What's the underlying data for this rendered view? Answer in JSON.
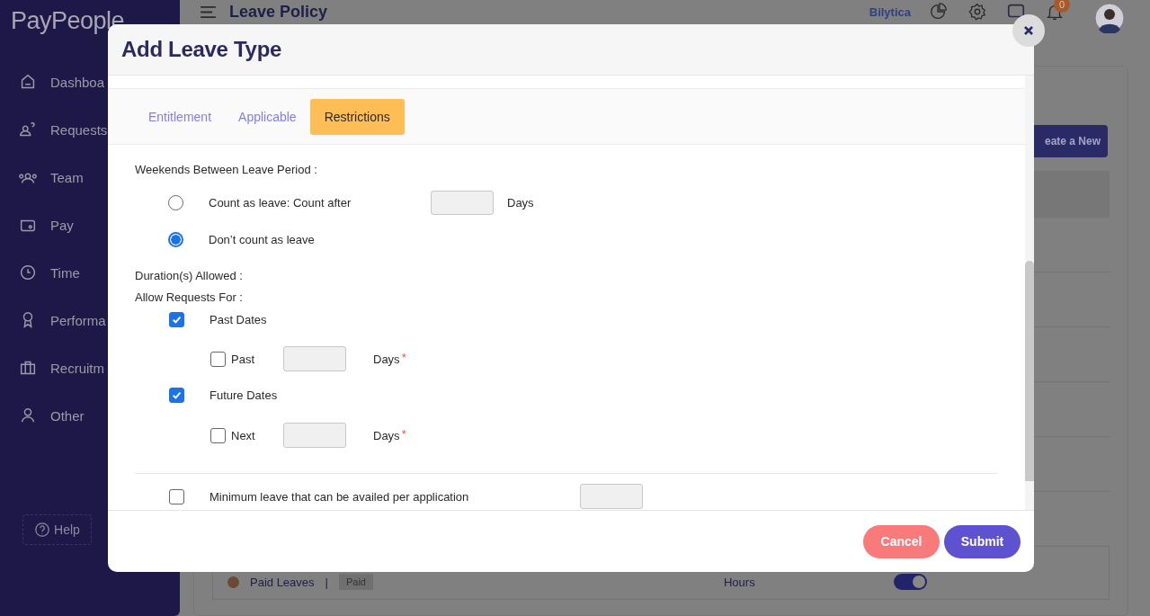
{
  "app": {
    "logo": "PayPeople",
    "page_title": "Leave Policy",
    "company": "Bilytica",
    "notification_count": "0",
    "sidebar": {
      "items": [
        {
          "label": "Dashboa"
        },
        {
          "label": "Requests"
        },
        {
          "label": "Team"
        },
        {
          "label": "Pay"
        },
        {
          "label": "Time"
        },
        {
          "label": "Performa"
        },
        {
          "label": "Recruitm"
        },
        {
          "label": "Other"
        }
      ],
      "help": "Help"
    },
    "create_button": "eate a New",
    "visible_row": {
      "name": "Paid Leaves",
      "separator": "|",
      "tag": "Paid",
      "unit": "Hours",
      "toggle_on": true
    }
  },
  "dialog": {
    "title": "Add Leave Type",
    "tabs": [
      {
        "label": "Entitlement",
        "selected": false
      },
      {
        "label": "Applicable",
        "selected": false
      },
      {
        "label": "Restrictions",
        "selected": true
      }
    ],
    "weekends": {
      "label": "Weekends Between Leave Period :",
      "options": [
        {
          "label": "Count as leave: Count after",
          "selected": false,
          "unit": "Days"
        },
        {
          "label": "Don’t count as leave",
          "selected": true
        }
      ]
    },
    "durations_label": "Duration(s) Allowed :",
    "allow_label": "Allow Requests For :",
    "request_options": [
      {
        "label": "Past Dates",
        "checked": true,
        "limit": {
          "label": "Past",
          "checked": false,
          "unit": "Days",
          "required_mark": "*"
        }
      },
      {
        "label": "Future Dates",
        "checked": true,
        "limit": {
          "label": "Next",
          "checked": false,
          "unit": "Days",
          "required_mark": "*"
        }
      }
    ],
    "minimum": {
      "label": "Minimum leave that can be availed per application",
      "checked": false
    },
    "buttons": [
      {
        "label": "Cancel",
        "kind": "cancel"
      },
      {
        "label": "Submit",
        "kind": "submit"
      }
    ]
  }
}
